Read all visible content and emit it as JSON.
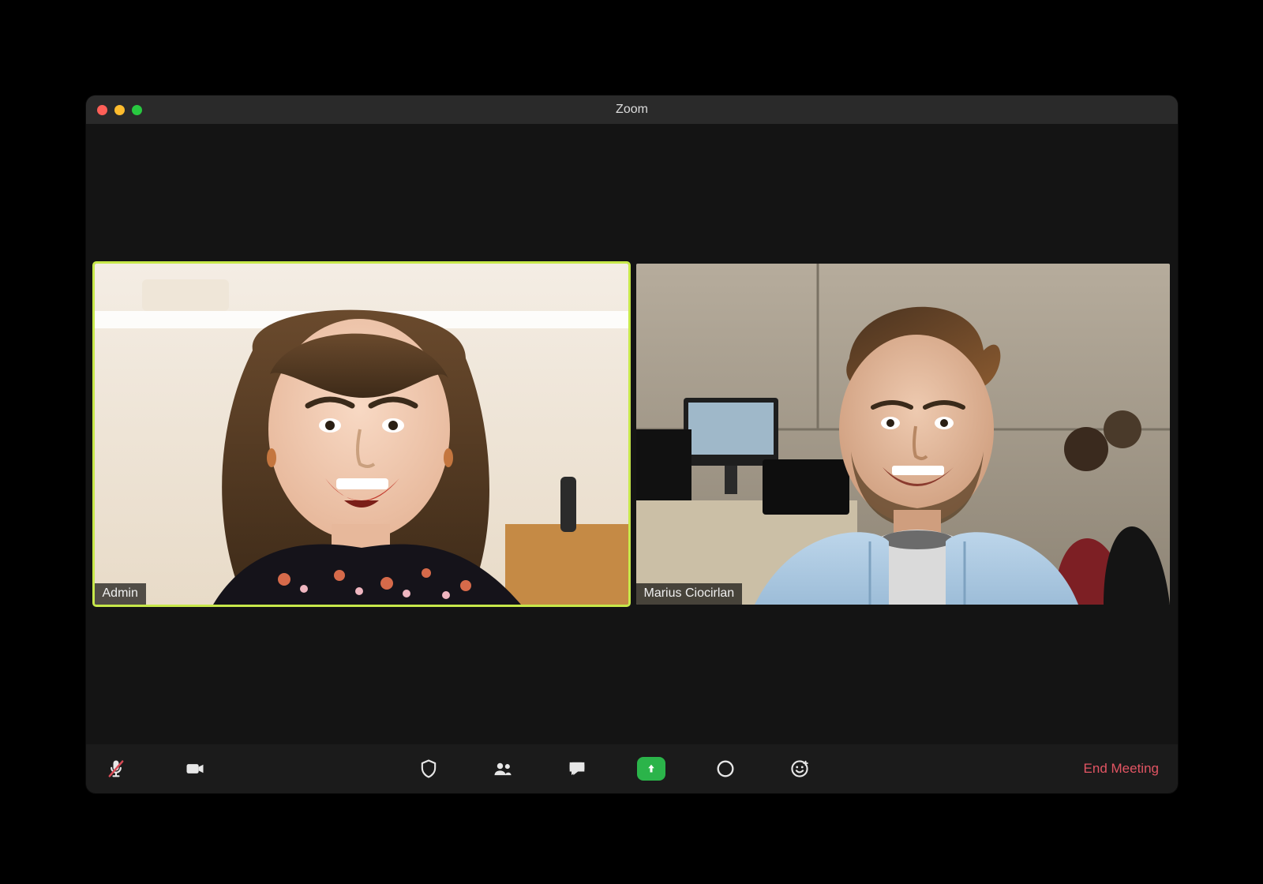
{
  "window": {
    "title": "Zoom"
  },
  "participants": [
    {
      "name": "Admin",
      "active_speaker": true
    },
    {
      "name": "Marius Ciocirlan",
      "active_speaker": false
    }
  ],
  "toolbar": {
    "mute_label": "Mute",
    "muted": true,
    "video_label": "Stop Video",
    "security_label": "Security",
    "participants_label": "Participants",
    "chat_label": "Chat",
    "share_label": "Share Screen",
    "record_label": "Record",
    "reactions_label": "Reactions",
    "end_label": "End Meeting"
  },
  "colors": {
    "active_border": "#c7e84a",
    "share_green": "#2bb44a",
    "end_red": "#e25563",
    "mute_slash": "#d74b56"
  }
}
